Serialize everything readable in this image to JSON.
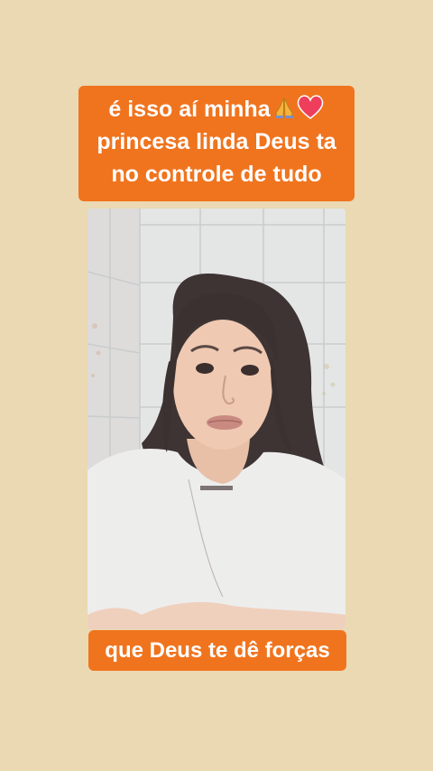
{
  "captions": {
    "top_line1": "é isso aí minha",
    "top_line2": "princesa linda Deus ta",
    "top_line3": "no controle de tudo",
    "bottom": "que Deus te dê forças"
  },
  "emojis": [
    "folded-hands-icon",
    "heart-icon"
  ],
  "colors": {
    "background": "#ead9b3",
    "caption_background": "#f0741e",
    "caption_text": "#ffffff"
  }
}
